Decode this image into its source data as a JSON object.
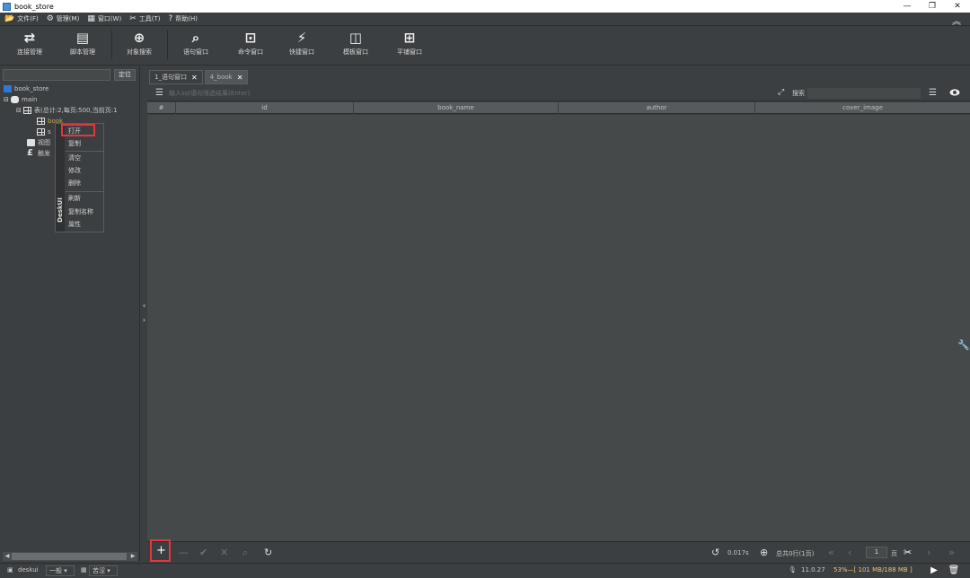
{
  "window": {
    "title": "book_store",
    "minimize": "—",
    "restore": "❐",
    "close": "✕"
  },
  "menu": [
    {
      "icon": "📂",
      "label": "文件(F)"
    },
    {
      "icon": "⚙",
      "label": "管理(M)"
    },
    {
      "icon": "▦",
      "label": "窗口(W)"
    },
    {
      "icon": "✂",
      "label": "工具(T)"
    },
    {
      "icon": "?",
      "label": "帮助(H)"
    }
  ],
  "toolbar": [
    {
      "icon": "⇄",
      "label": "连接管理"
    },
    {
      "icon": "▤",
      "label": "脚本管理"
    },
    {
      "icon": "⊕",
      "label": "对象搜索"
    },
    {
      "icon": "⌕",
      "label": "语句窗口"
    },
    {
      "icon": "⊡",
      "label": "命令窗口"
    },
    {
      "icon": "⚡",
      "label": "快捷窗口"
    },
    {
      "icon": "◫",
      "label": "模板窗口"
    },
    {
      "icon": "⊞",
      "label": "平铺窗口"
    }
  ],
  "left": {
    "locate_label": "定位",
    "tree": {
      "db": "book_store",
      "schema": "main",
      "tables_label": "表(总计:2,每页:500,当前页:1",
      "table1": "book",
      "table2_prefix": "s",
      "table2_suffix": "ce",
      "views_prefix": "视图",
      "triggers_prefix": "触发"
    }
  },
  "context_menu": {
    "brand": "DeskUI",
    "items": [
      "打开",
      "复制",
      "清空",
      "修改",
      "删除",
      "刷新",
      "复制名称",
      "属性"
    ]
  },
  "tabs": [
    {
      "label": "1_语句窗口"
    },
    {
      "label": "4_book"
    }
  ],
  "main": {
    "filter_placeholder": "输入sql语句筛选结果(Enter)",
    "search_label": "搜索",
    "columns": [
      "#",
      "id",
      "book_name",
      "author",
      "cover_image"
    ],
    "exec_time": "0.017s",
    "total_text": "总共0行(1页)",
    "page_value": "1",
    "page_unit": "页"
  },
  "status": {
    "user": "deskui",
    "mode": "一般",
    "lang": "苦涩",
    "version": "11.0.27",
    "memory": "53%—[ 101 MB/188 MB ]"
  }
}
